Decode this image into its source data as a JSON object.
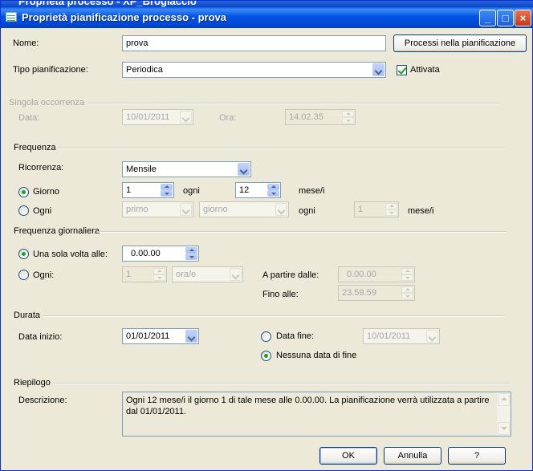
{
  "background_window_title": "Proprietà processo - XP_Broglaccio",
  "window": {
    "title": "Proprietà pianificazione processo - prova",
    "minimize": "_",
    "maximize": "□",
    "close": "×"
  },
  "nome": {
    "label": "Nome:",
    "value": "prova"
  },
  "processi_button": "Processi nella pianificazione",
  "tipo": {
    "label": "Tipo pianificazione:",
    "value": "Periodica"
  },
  "attivata": {
    "label": "Attivata",
    "checked": true
  },
  "singola": {
    "group": "Singola occorrenza",
    "data_label": "Data:",
    "data_value": "10/01/2011",
    "ora_label": "Ora:",
    "ora_value": "14.02.35"
  },
  "frequenza": {
    "group": "Frequenza",
    "ricorrenza_label": "Ricorrenza:",
    "ricorrenza_value": "Mensile",
    "giorno_label": "Giorno",
    "giorno_value": "1",
    "ogni_label": "ogni",
    "mesi_value": "12",
    "mesi_label": "mese/i",
    "ogni2_label": "Ogni",
    "primo_value": "primo",
    "giorno_combo_value": "giorno",
    "ogni3_label": "ogni",
    "ogni3_value": "1",
    "mesi2_label": "mese/i"
  },
  "giornaliera": {
    "group": "Frequenza giornaliera",
    "una_label": "Una sola volta alle:",
    "una_value": "0.00.00",
    "ogni_label": "Ogni:",
    "ogni_value": "1",
    "unit_value": "ora/e",
    "a_partire_label": "A partire dalle:",
    "a_partire_value": "0.00.00",
    "fino_label": "Fino alle:",
    "fino_value": "23.59.59"
  },
  "durata": {
    "group": "Durata",
    "inizio_label": "Data inizio:",
    "inizio_value": "01/01/2011",
    "fine_label": "Data fine:",
    "fine_value": "10/01/2011",
    "nessuna_label": "Nessuna data di fine"
  },
  "riepilogo": {
    "group": "Riepilogo",
    "descr_label": "Descrizione:",
    "descr_value": "Ogni 12 mese/i il giorno 1 di tale mese alle 0.00.00. La pianificazione verrà utilizzata a partire dal 01/01/2011."
  },
  "buttons": {
    "ok": "OK",
    "annulla": "Annulla",
    "help": "?"
  }
}
